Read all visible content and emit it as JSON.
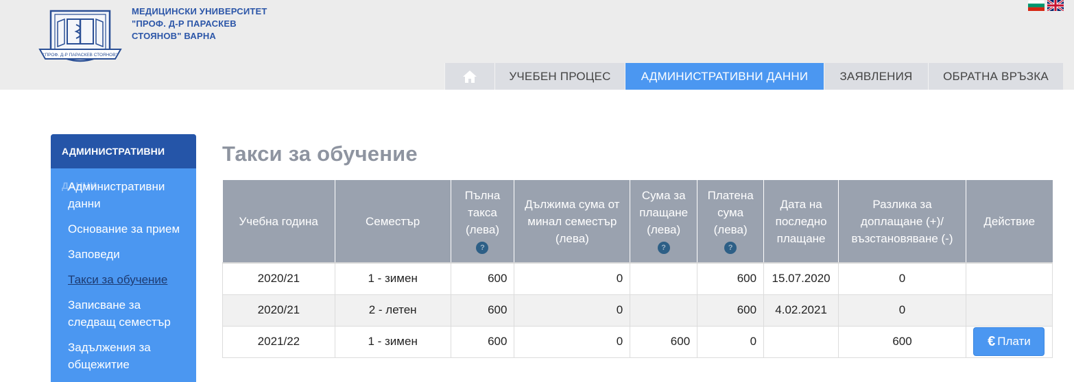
{
  "header": {
    "university_lines": [
      "МЕДИЦИНСКИ УНИВЕРСИТЕТ",
      "\"ПРОФ. Д-Р ПАРАСКЕВ",
      "СТОЯНОВ\" ВАРНА"
    ],
    "logo_text": "\"ПРОФ. Д-Р ПАРАСКЕВ СТОЯНОВ\""
  },
  "nav": {
    "items": [
      "УЧЕБЕН ПРОЦЕС",
      "АДМИНИСТРАТИВНИ ДАННИ",
      "ЗАЯВЛЕНИЯ",
      "ОБРАТНА ВРЪЗКА"
    ],
    "active": "АДМИНИСТРАТИВНИ ДАННИ"
  },
  "sidebar": {
    "heading": "АДМИНИСТРАТИВНИ",
    "heading_overflow": "ДАННИ",
    "items": [
      "Административни данни",
      "Основание за прием",
      "Заповеди",
      "Такси за обучение",
      "Записване за следващ семестър",
      "Задължения за общежитие"
    ],
    "current": "Такси за обучение"
  },
  "page": {
    "title": "Такси за обучение"
  },
  "table": {
    "headers": [
      "Учебна година",
      "Семестър",
      "Пълна такса (лева)",
      "Дължима сума от минал семестър (лева)",
      "Сума за плащане (лева)",
      "Платена сума (лева)",
      "Дата на последно плащане",
      "Разлика за доплащане (+)/възстановяване (-)",
      "Действие"
    ],
    "help_mark": "?",
    "rows": [
      [
        "2020/21",
        "1  - зимен",
        "600",
        "0",
        "",
        "600",
        "15.07.2020",
        "0",
        ""
      ],
      [
        "2020/21",
        "2  - летен",
        "600",
        "0",
        "",
        "600",
        "4.02.2021",
        "0",
        ""
      ],
      [
        "2021/22",
        "1  - зимен",
        "600",
        "0",
        "600",
        "0",
        "",
        "600",
        ""
      ]
    ],
    "pay_button": "Плати",
    "pay_icon": "€"
  }
}
